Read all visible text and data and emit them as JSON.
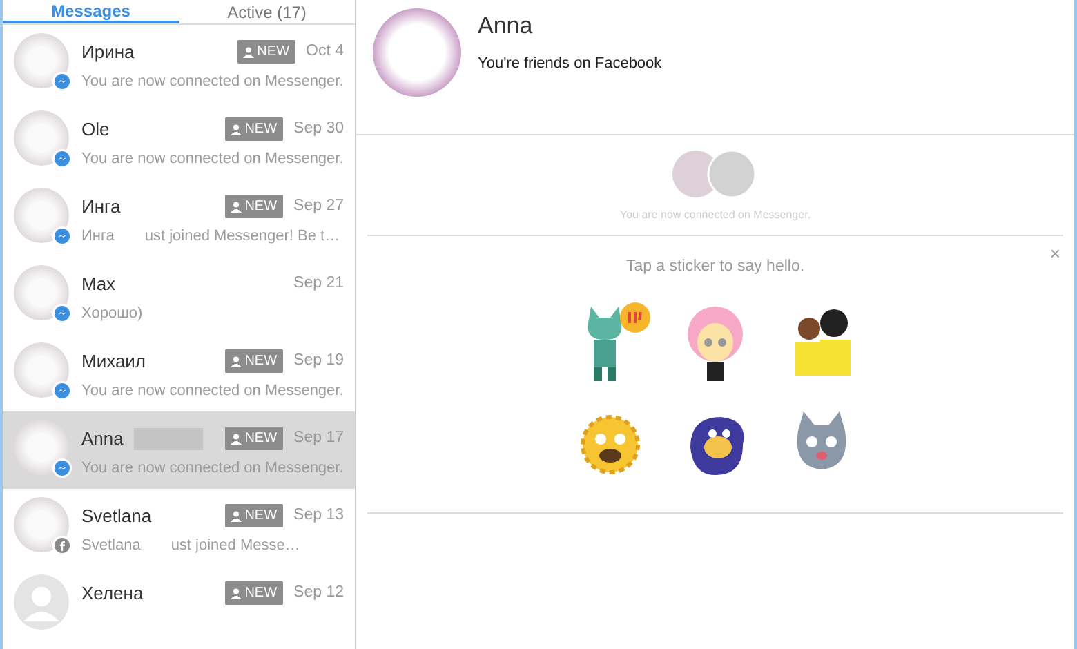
{
  "sidebar": {
    "tabs": [
      {
        "label": "Messages",
        "selected": true
      },
      {
        "label": "Active (17)",
        "selected": false
      }
    ],
    "conversations": [
      {
        "name": "Ирина",
        "new_badge": "NEW",
        "date": "Oct 4",
        "snippet": "You are now connected on Messenger.",
        "photo": true,
        "messenger": true,
        "facebook": false,
        "selected": false,
        "redacted": false
      },
      {
        "name": "Ole",
        "new_badge": "NEW",
        "date": "Sep 30",
        "snippet": "You are now connected on Messenger.",
        "photo": true,
        "messenger": true,
        "facebook": false,
        "selected": false,
        "redacted": false
      },
      {
        "name": "Инга",
        "new_badge": "NEW",
        "date": "Sep 27",
        "snippet": "Инга",
        "snippet_tail": "ust joined Messenger! Be t…",
        "photo": true,
        "messenger": true,
        "facebook": false,
        "selected": false,
        "redacted": false
      },
      {
        "name": "Max",
        "date": "Sep 21",
        "snippet": "Хорошо)",
        "photo": true,
        "messenger": true,
        "facebook": false,
        "selected": false,
        "redacted": false
      },
      {
        "name": "Михаил",
        "new_badge": "NEW",
        "date": "Sep 19",
        "snippet": "You are now connected on Messenger.",
        "photo": true,
        "messenger": true,
        "facebook": false,
        "selected": false,
        "redacted": false
      },
      {
        "name": "Anna",
        "new_badge": "NEW",
        "date": "Sep 17",
        "snippet": "You are now connected on Messenger.",
        "photo": true,
        "messenger": true,
        "facebook": false,
        "selected": true,
        "redacted": true
      },
      {
        "name": "Svetlana",
        "new_badge": "NEW",
        "date": "Sep 13",
        "snippet": "Svetlana",
        "snippet_tail": "ust joined Messe…",
        "photo": true,
        "messenger": false,
        "facebook": true,
        "selected": false,
        "redacted": false
      },
      {
        "name": "Хелена",
        "new_badge": "NEW",
        "date": "Sep 12",
        "photo": false,
        "messenger": false,
        "facebook": false,
        "selected": false,
        "redacted": false
      }
    ]
  },
  "conversation": {
    "name": "Anna",
    "subtitle": "You're friends on Facebook",
    "connected_text": "You are now connected on Messenger.",
    "sticker_prompt": "Tap a sticker to say hello.",
    "close": "×"
  }
}
